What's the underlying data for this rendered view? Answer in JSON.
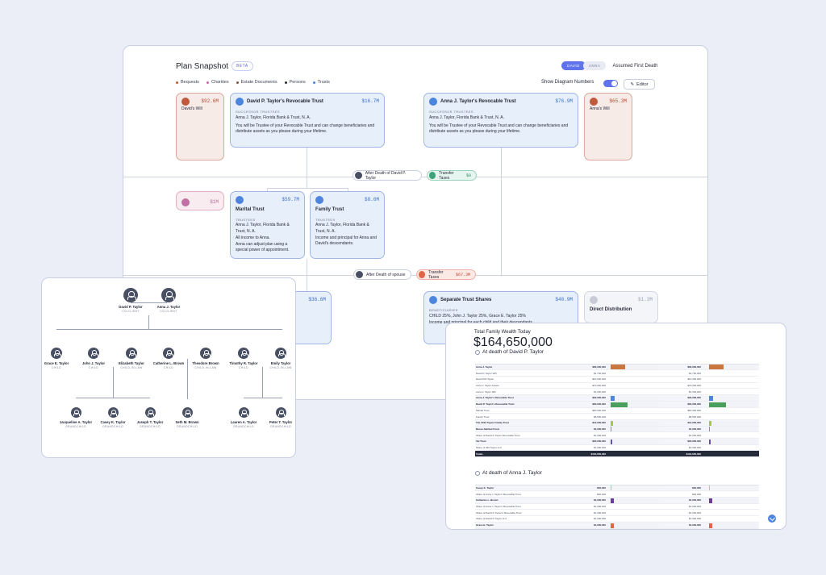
{
  "snapshot": {
    "title": "Plan Snapshot",
    "beta": "BETA",
    "legend": [
      {
        "label": "Bequests",
        "color": "#c05a3e"
      },
      {
        "label": "Charities",
        "color": "#c26fa5"
      },
      {
        "label": "Estate Documents",
        "color": "#8a5238"
      },
      {
        "label": "Persons",
        "color": "#2a2d3c"
      },
      {
        "label": "Trusts",
        "color": "#4d84de"
      }
    ],
    "toggle": {
      "david": "DAVID",
      "anna": "ANNA",
      "label": "Assumed First Death"
    },
    "show_numbers": "Show Diagram Numbers",
    "editor": "Editor",
    "david_will": {
      "name": "David's Will",
      "amount": "$92.6M"
    },
    "anna_will": {
      "name": "Anna's Will",
      "amount": "$65.3M"
    },
    "david_trust": {
      "name": "David P. Taylor's Revocable Trust",
      "amount": "$16.7M",
      "label": "SUCCESSOR TRUSTEES",
      "trustees": "Anna J. Taylor, Florida Bank & Trust, N. A.",
      "desc": "You will be Trustee of your Revocable Trust and can change beneficiaries and distribute assets as you please during your lifetime."
    },
    "anna_trust": {
      "name": "Anna J. Taylor's Revocable Trust",
      "amount": "$76.9M",
      "label": "SUCCESSOR TRUSTEES",
      "trustees": "Anna J. Taylor, Florida Bank & Trust, N. A.",
      "desc": "You will be Trustee of your Revocable Trust and can change beneficiaries and distribute assets as you please during your lifetime."
    },
    "after_death_1": "After Death of David P. Taylor",
    "transfer_1": {
      "label": "Transfer Taxes",
      "amount": "$0"
    },
    "charity": {
      "amount": "$1M"
    },
    "marital": {
      "name": "Marital Trust",
      "amount": "$59.7M",
      "label": "TRUSTEES",
      "trustees": "Anna J. Taylor, Florida Bank & Trust, N. A.",
      "desc1": "All income to Anna.",
      "desc2": "Anna can adjust plan using a special power of appointment."
    },
    "family": {
      "name": "Family Trust",
      "amount": "$8.6M",
      "label": "TRUSTEES",
      "trustees": "Anna J. Taylor, Florida Bank & Trust, N. A.",
      "desc": "Income and principal for Anna and David's descendants."
    },
    "after_death_2": "After Death of spouse",
    "transfer_2": {
      "label": "Transfer Taxes",
      "amount": "$67.3M"
    },
    "partial_amount": "$36.6M",
    "separate": {
      "name": "Separate Trust Shares",
      "amount": "$40.9M",
      "label": "BENEFICIARIES",
      "benef": "CHILD 25%, John J. Taylor 25%, Grace E. Taylor 25%",
      "desc": "Income and principal for each child and their descendants."
    },
    "direct": {
      "name": "Direct Distribution",
      "amount": "$1.3M"
    }
  },
  "family_tree": {
    "clients": [
      {
        "name": "David P. Taylor",
        "role": "CO-CLIENT"
      },
      {
        "name": "Anna J. Taylor",
        "role": "CO-CLIENT"
      }
    ],
    "children": [
      {
        "name": "Grace E. Taylor",
        "role": "CHILD"
      },
      {
        "name": "John J. Taylor",
        "role": "CHILD"
      },
      {
        "name": "Elizabeth Taylor",
        "role": "CHILD-IN-LAW"
      },
      {
        "name": "Catherine L. Brown",
        "role": "CHILD"
      },
      {
        "name": "Theodore Brown",
        "role": "CHILD-IN-LAW"
      },
      {
        "name": "Timothy R. Taylor",
        "role": "CHILD"
      },
      {
        "name": "Emily Taylor",
        "role": "CHILD-IN-LAW"
      }
    ],
    "grandchildren": [
      {
        "name": "Jacqueline A. Taylor",
        "role": "GRANDCHILD"
      },
      {
        "name": "Casey K. Taylor",
        "role": "GRANDCHILD"
      },
      {
        "name": "Joseph T. Taylor",
        "role": "GRANDCHILD"
      },
      {
        "name": "Seth M. Brown",
        "role": "GRANDCHILD"
      },
      {
        "name": "Lauren A. Taylor",
        "role": "GRANDCHILD"
      },
      {
        "name": "Peter T. Taylor",
        "role": "GRANDCHILD"
      }
    ]
  },
  "wealth": {
    "title": "Total Family Wealth Today",
    "total": "$164,650,000",
    "section1": "At death of David P. Taylor",
    "section2": "At death of Anna J. Taylor",
    "rows1": [
      {
        "name": "Anna J. Taylor",
        "v1": "$60,000,000",
        "v2": "$60,000,000",
        "w": 0.3,
        "c": "#c9773f",
        "bold": true
      },
      {
        "name": "David P. Taylor Will",
        "v1": "$1,700,000",
        "v2": "$1,700,000",
        "w": 0,
        "c": "#fff",
        "bold": false
      },
      {
        "name": "David IRA Taylor",
        "v1": "$10,000,000",
        "v2": "$10,000,000",
        "w": 0,
        "c": "#fff",
        "bold": false
      },
      {
        "name": "Anna J. Taylor Assets",
        "v1": "$70,000,000",
        "v2": "$70,000,000",
        "w": 0,
        "c": "#fff",
        "bold": false
      },
      {
        "name": "Anna J. Taylor IRA",
        "v1": "$1,000,000",
        "v2": "$1,000,000",
        "w": 0,
        "c": "#fff",
        "bold": false
      },
      {
        "name": "Anna J. Taylor's Revocable Trust",
        "v1": "$22,000,000",
        "v2": "$22,000,000",
        "w": 0.08,
        "c": "#4d84de",
        "bold": true
      },
      {
        "name": "David P. Taylor's Revocable Trust",
        "v1": "$60,000,000",
        "v2": "$60,000,000",
        "w": 0.35,
        "c": "#4aa05a",
        "bold": true
      },
      {
        "name": "Marital Trust",
        "v1": "$60,000,000",
        "v2": "$60,000,000",
        "w": 0,
        "c": "#fff",
        "bold": false
      },
      {
        "name": "Family Trust",
        "v1": "$8,600,000",
        "v2": "$8,600,000",
        "w": 0,
        "c": "#fff",
        "bold": false
      },
      {
        "name": "The 2012 Taylor Family Trust",
        "v1": "$12,000,000",
        "v2": "$12,000,000",
        "w": 0.05,
        "c": "#a6c940",
        "bold": true
      },
      {
        "name": "Nassa Sahited Fund",
        "v1": "$1,000,000",
        "v2": "$1,000,000",
        "w": 0.02,
        "c": "#c26fa5",
        "bold": true
      },
      {
        "name": "Share of David P. Taylor Revocable Trust",
        "v1": "$1,000,000",
        "v2": "$1,000,000",
        "w": 0,
        "c": "#fff",
        "bold": false
      },
      {
        "name": "Vel Trust",
        "v1": "$20,000,000",
        "v2": "$20,000,000",
        "w": 0.04,
        "c": "#6a4fb0",
        "bold": true
      },
      {
        "name": "Share of IRA Taylor LLC",
        "v1": "$1,000,000",
        "v2": "$1,000,000",
        "w": 0,
        "c": "#fff",
        "bold": false
      }
    ],
    "rows2": [
      {
        "name": "Casey K. Taylor",
        "v1": "$30,000",
        "v2": "$30,000",
        "w": 0.02,
        "c": "#e8a7a7",
        "bold": true
      },
      {
        "name": "Share of Anna J. Taylor's Revocable Trust",
        "v1": "$30,000",
        "v2": "$30,000",
        "w": 0,
        "c": "#fff",
        "bold": false
      },
      {
        "name": "Catherine L. Brown",
        "v1": "$1,000,000",
        "v2": "$1,000,000",
        "w": 0.06,
        "c": "#6a3c9a",
        "bold": true
      },
      {
        "name": "Share of Anna J. Taylor's Revocable Trust",
        "v1": "$1,000,000",
        "v2": "$1,000,000",
        "w": 0,
        "c": "#fff",
        "bold": false
      },
      {
        "name": "Share of David P. Taylor's Revocable Trust",
        "v1": "$1,000,000",
        "v2": "$1,000,000",
        "w": 0,
        "c": "#fff",
        "bold": false
      },
      {
        "name": "Share of David P. Taylor LLC",
        "v1": "$1,000,000",
        "v2": "$1,000,000",
        "w": 0,
        "c": "#fff",
        "bold": false
      },
      {
        "name": "Grace E. Taylor",
        "v1": "$1,000,000",
        "v2": "$1,000,000",
        "w": 0.06,
        "c": "#e2654a",
        "bold": true
      }
    ],
    "total_label": "Totals",
    "total_v1": "$164,650,000",
    "total_v2": "$164,650,000"
  }
}
